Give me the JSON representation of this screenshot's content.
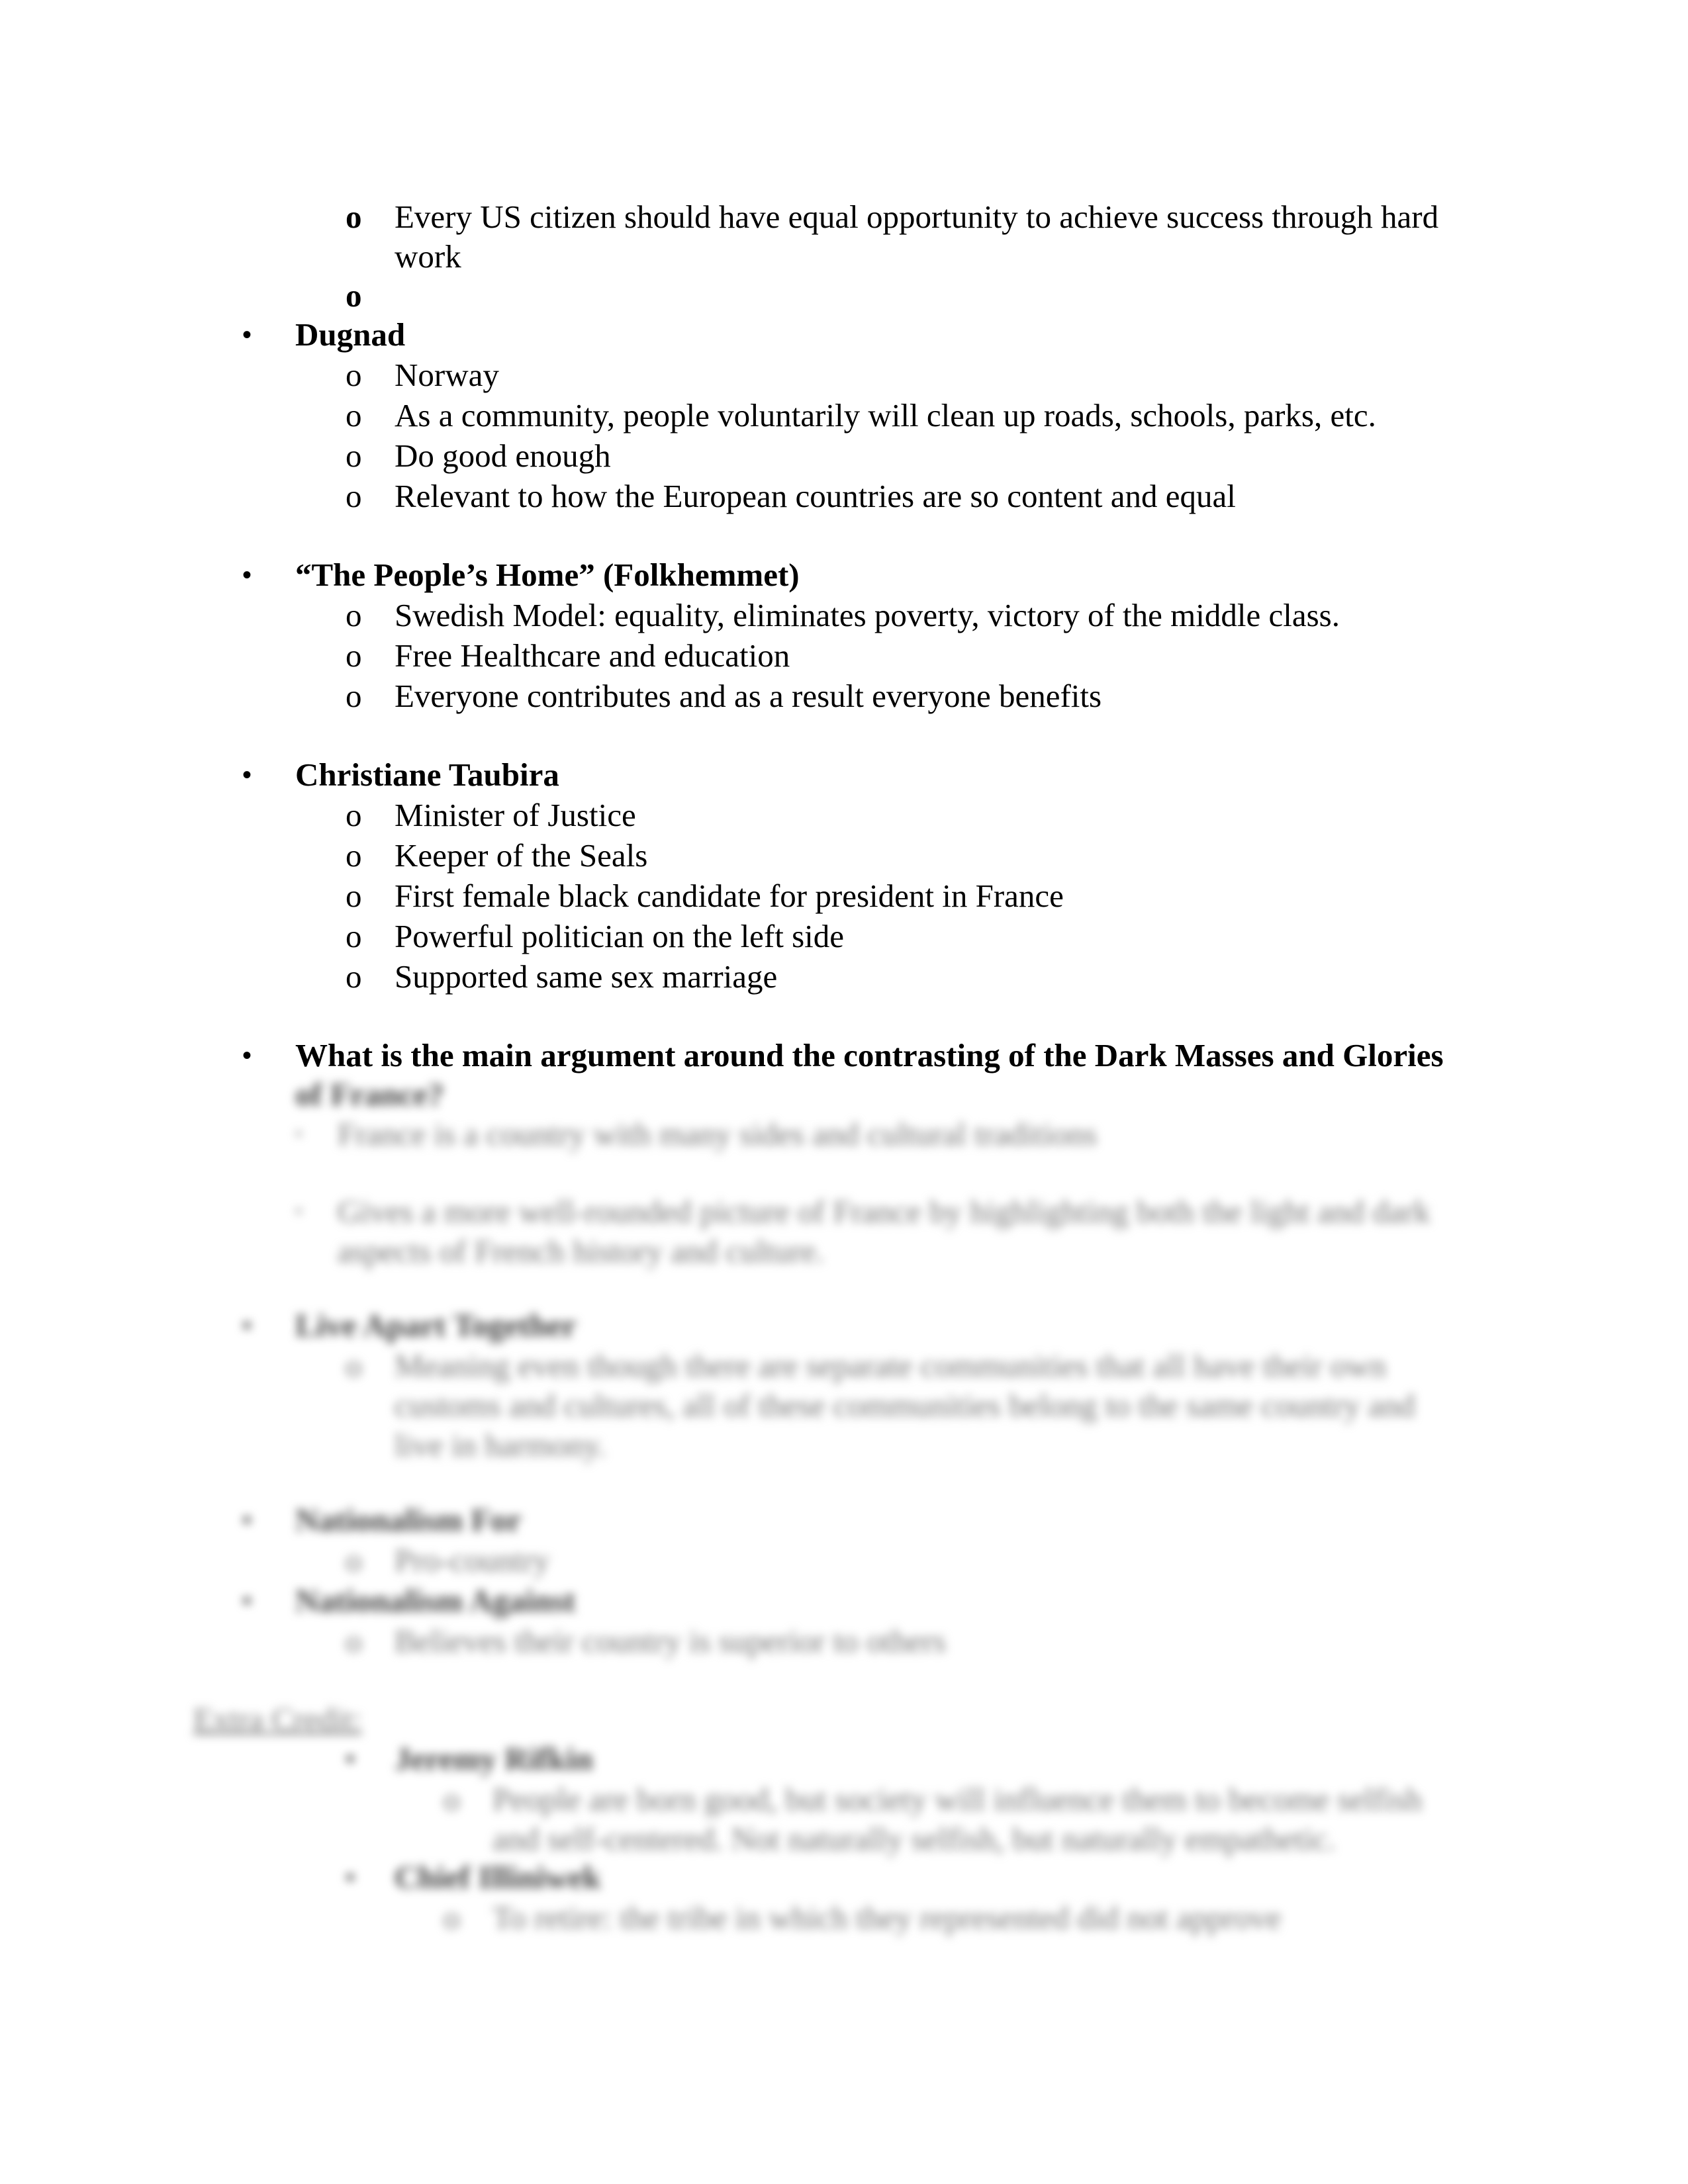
{
  "document": {
    "sections": [
      {
        "id": "american-dream-tail",
        "items": [
          "Every US citizen should have equal opportunity to achieve success through hard",
          "work",
          ""
        ]
      },
      {
        "id": "dugnad",
        "title": "Dugnad",
        "items": [
          "Norway",
          "As a community, people voluntarily will clean up roads, schools, parks, etc.",
          "Do good enough",
          "Relevant to how the European countries are so content and equal"
        ]
      },
      {
        "id": "peoples-home",
        "title": "“The People’s Home” (Folkhemmet)",
        "items": [
          "Swedish Model: equality, eliminates poverty, victory of the middle class.",
          "Free Healthcare and education",
          "Everyone contributes and as a result everyone benefits"
        ]
      },
      {
        "id": "taubira",
        "title": "Christiane Taubira",
        "items": [
          "Minister of Justice",
          "Keeper of the Seals",
          "First female black candidate for president in France",
          "Powerful politician on the left side",
          "Supported same sex marriage"
        ]
      },
      {
        "id": "dark-masses",
        "title_line1": "What is the main argument around the contrasting of the Dark Masses and Glories",
        "title_line2": "of France?",
        "items": [
          "France is a country with many sides and cultural traditions",
          "Gives a more well-rounded picture of France by highlighting both the light and dark",
          "aspects of French history and culture."
        ]
      },
      {
        "id": "live-apart",
        "title": "Live Apart Together",
        "items": [
          "Meaning even though there are separate communities that all have their own",
          "customs and cultures, all of these communities belong to the same country and",
          "live in harmony."
        ]
      },
      {
        "id": "nationalism-for",
        "title": "Nationalism For",
        "items": [
          "Pro-country"
        ]
      },
      {
        "id": "nationalism-against",
        "title": "Nationalism Against",
        "items": [
          "Believes their country is superior to others"
        ]
      },
      {
        "id": "extra-credit",
        "label": "Extra Credit:",
        "subsections": [
          {
            "title": "Jeremy Rifkin",
            "items": [
              "People are born good, but society will influence them to become selfish",
              "and self-centered. Not naturally selfish, but naturally empathetic."
            ]
          },
          {
            "title": "Chief Illiniwek",
            "items": [
              "To retire: the tribe in which they represented did not approve"
            ]
          }
        ]
      }
    ],
    "bullets": {
      "level1": "•",
      "level2": "o"
    }
  }
}
